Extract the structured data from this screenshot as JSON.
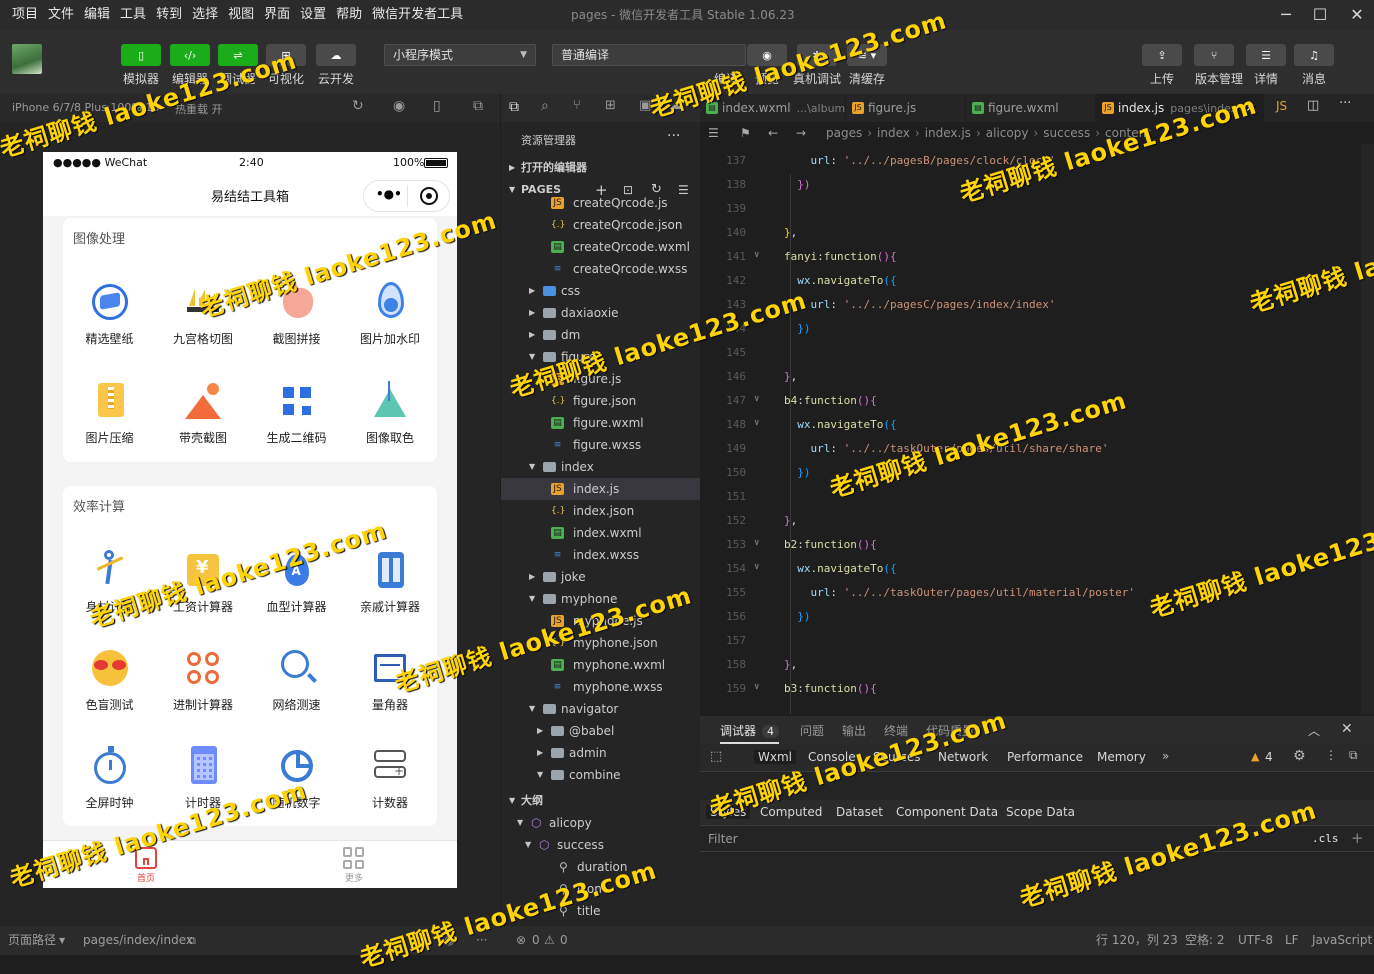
{
  "menu": [
    "项目",
    "文件",
    "编辑",
    "工具",
    "转到",
    "选择",
    "视图",
    "界面",
    "设置",
    "帮助",
    "微信开发者工具"
  ],
  "window_title": "pages - 微信开发者工具 Stable 1.06.23",
  "toolbar": {
    "left": [
      {
        "label": "模拟器",
        "icon": "phone-icon"
      },
      {
        "label": "编辑器",
        "icon": "code-icon"
      },
      {
        "label": "调试器",
        "icon": "debug-icon"
      },
      {
        "label": "可视化",
        "icon": "layout-icon"
      },
      {
        "label": "云开发",
        "icon": "cloud-icon"
      }
    ],
    "mode_select": "小程序模式",
    "compile_select": "普通编译",
    "mid": [
      {
        "label": "编译",
        "icon": "refresh-icon"
      },
      {
        "label": "预览",
        "icon": "eye-icon"
      },
      {
        "label": "真机调试",
        "icon": "bug-icon"
      },
      {
        "label": "清缓存",
        "icon": "layers-icon"
      }
    ],
    "right": [
      {
        "label": "上传",
        "icon": "upload-icon"
      },
      {
        "label": "版本管理",
        "icon": "branch-icon"
      },
      {
        "label": "详情",
        "icon": "menu-icon"
      },
      {
        "label": "消息",
        "icon": "bell-icon"
      }
    ]
  },
  "simulator": {
    "device": "iPhone 6/7/8 Plus 100% 16",
    "hot_reload": "热重载 开",
    "status_carrier": "●●●●● WeChat",
    "status_time": "2:40",
    "status_battery": "100%",
    "nav_title": "易结结工具箱",
    "sections": [
      {
        "title": "图像处理",
        "tools": [
          {
            "label": "精选壁纸",
            "icon": "wallpaper-icon"
          },
          {
            "label": "九宫格切图",
            "icon": "crown-grid-icon"
          },
          {
            "label": "截图拼接",
            "icon": "pig-icon"
          },
          {
            "label": "图片加水印",
            "icon": "water-drop-icon"
          },
          {
            "label": "图片压缩",
            "icon": "zip-icon"
          },
          {
            "label": "带壳截图",
            "icon": "mountain-icon"
          },
          {
            "label": "生成二维码",
            "icon": "qrcode-icon"
          },
          {
            "label": "图像取色",
            "icon": "color-picker-icon"
          }
        ]
      },
      {
        "title": "效率计算",
        "tools": [
          {
            "label": "身材计算",
            "icon": "body-icon"
          },
          {
            "label": "工资计算器",
            "icon": "yen-icon"
          },
          {
            "label": "血型计算器",
            "icon": "blood-drop-icon"
          },
          {
            "label": "亲戚计算器",
            "icon": "calculator-icon"
          },
          {
            "label": "色盲测试",
            "icon": "sunglasses-emoji-icon"
          },
          {
            "label": "进制计算器",
            "icon": "math-ops-icon"
          },
          {
            "label": "网络测速",
            "icon": "speed-search-icon"
          },
          {
            "label": "量角器",
            "icon": "ruler-icon"
          },
          {
            "label": "全屏时钟",
            "icon": "stopwatch-icon"
          },
          {
            "label": "计时器",
            "icon": "grid-calc-icon"
          },
          {
            "label": "随机数字",
            "icon": "pie-icon"
          },
          {
            "label": "计数器",
            "icon": "counter-icon"
          }
        ]
      }
    ],
    "tabs": [
      {
        "label": "首页",
        "icon": "home-icon"
      },
      {
        "label": "更多",
        "icon": "apps-icon"
      }
    ]
  },
  "explorer": {
    "title": "资源管理器",
    "open_editors": "打开的编辑器",
    "root": "PAGES",
    "outline": "大纲",
    "tree": [
      {
        "name": "createQrcode.js",
        "type": "js",
        "depth": 3
      },
      {
        "name": "createQrcode.json",
        "type": "json",
        "depth": 3
      },
      {
        "name": "createQrcode.wxml",
        "type": "wxml",
        "depth": 3
      },
      {
        "name": "createQrcode.wxss",
        "type": "wxss",
        "depth": 3
      },
      {
        "name": "css",
        "type": "folder-blue",
        "depth": 2,
        "state": "closed"
      },
      {
        "name": "daxiaoxie",
        "type": "folder",
        "depth": 2,
        "state": "closed"
      },
      {
        "name": "dm",
        "type": "folder",
        "depth": 2,
        "state": "closed"
      },
      {
        "name": "figure",
        "type": "folder",
        "depth": 2,
        "state": "open"
      },
      {
        "name": "figure.js",
        "type": "js",
        "depth": 3
      },
      {
        "name": "figure.json",
        "type": "json",
        "depth": 3
      },
      {
        "name": "figure.wxml",
        "type": "wxml",
        "depth": 3
      },
      {
        "name": "figure.wxss",
        "type": "wxss",
        "depth": 3
      },
      {
        "name": "index",
        "type": "folder",
        "depth": 2,
        "state": "open"
      },
      {
        "name": "index.js",
        "type": "js",
        "depth": 3,
        "selected": true
      },
      {
        "name": "index.json",
        "type": "json",
        "depth": 3
      },
      {
        "name": "index.wxml",
        "type": "wxml",
        "depth": 3
      },
      {
        "name": "index.wxss",
        "type": "wxss",
        "depth": 3
      },
      {
        "name": "joke",
        "type": "folder",
        "depth": 2,
        "state": "closed"
      },
      {
        "name": "myphone",
        "type": "folder",
        "depth": 2,
        "state": "open"
      },
      {
        "name": "myphone.js",
        "type": "js",
        "depth": 3
      },
      {
        "name": "myphone.json",
        "type": "json",
        "depth": 3
      },
      {
        "name": "myphone.wxml",
        "type": "wxml",
        "depth": 3
      },
      {
        "name": "myphone.wxss",
        "type": "wxss",
        "depth": 3
      },
      {
        "name": "navigator",
        "type": "folder",
        "depth": 2,
        "state": "open"
      },
      {
        "name": "@babel",
        "type": "folder",
        "depth": 3,
        "state": "closed"
      },
      {
        "name": "admin",
        "type": "folder",
        "depth": 3,
        "state": "closed"
      },
      {
        "name": "combine",
        "type": "folder",
        "depth": 3,
        "state": "open"
      }
    ],
    "outline_items": [
      {
        "name": "alicopy",
        "type": "cube",
        "depth": 1
      },
      {
        "name": "success",
        "type": "cube",
        "depth": 2
      },
      {
        "name": "duration",
        "type": "wrench",
        "depth": 3
      },
      {
        "name": "icon",
        "type": "wrench",
        "depth": 3
      },
      {
        "name": "title",
        "type": "wrench",
        "depth": 3
      }
    ]
  },
  "editor": {
    "tabs": [
      {
        "name": "index.wxml",
        "hint": "...\\album",
        "type": "wxml"
      },
      {
        "name": "figure.js",
        "hint": "",
        "type": "js"
      },
      {
        "name": "figure.wxml",
        "hint": "",
        "type": "wxml"
      },
      {
        "name": "index.js",
        "hint": "pages\\index",
        "type": "js",
        "active": true
      }
    ],
    "breadcrumb": [
      "pages",
      "index",
      "index.js",
      "alicopy",
      "success",
      "content"
    ],
    "lines": [
      {
        "n": "137",
        "fold": false,
        "html": "    <span class='v'>url</span>: <span class='s'>'../../pagesB/pages/clock/clock'</span>"
      },
      {
        "n": "138",
        "fold": false,
        "html": "  <span class='b'>})</span>"
      },
      {
        "n": "139",
        "fold": false,
        "html": ""
      },
      {
        "n": "140",
        "fold": false,
        "html": "<span class='p'>}</span>,"
      },
      {
        "n": "141",
        "fold": true,
        "html": "<span class='k'>fanyi</span>:<span class='k'>function</span><span class='b'>()</span><span class='b'>{</span>"
      },
      {
        "n": "142",
        "fold": false,
        "html": "  <span class='v'>wx</span>.<span class='k'>navigateTo</span><span class='bl'>({</span>"
      },
      {
        "n": "143",
        "fold": false,
        "html": "    <span class='v'>url</span>: <span class='s'>'../../pagesC/pages/index/index'</span>"
      },
      {
        "n": "144",
        "fold": false,
        "html": "  <span class='bl'>})</span>"
      },
      {
        "n": "145",
        "fold": false,
        "html": ""
      },
      {
        "n": "146",
        "fold": false,
        "html": "<span class='b'>}</span>,"
      },
      {
        "n": "147",
        "fold": true,
        "html": "<span class='k'>b4</span>:<span class='k'>function</span><span class='b'>()</span><span class='b'>{</span>"
      },
      {
        "n": "148",
        "fold": true,
        "html": "  <span class='v'>wx</span>.<span class='k'>navigateTo</span><span class='bl'>({</span>"
      },
      {
        "n": "149",
        "fold": false,
        "html": "    <span class='v'>url</span>: <span class='s'>'../../taskOuter/pages/util/share/share'</span>"
      },
      {
        "n": "150",
        "fold": false,
        "html": "  <span class='bl'>})</span>"
      },
      {
        "n": "151",
        "fold": false,
        "html": ""
      },
      {
        "n": "152",
        "fold": false,
        "html": "<span class='b'>}</span>,"
      },
      {
        "n": "153",
        "fold": true,
        "html": "<span class='k'>b2</span>:<span class='k'>function</span><span class='b'>()</span><span class='b'>{</span>"
      },
      {
        "n": "154",
        "fold": true,
        "html": "  <span class='v'>wx</span>.<span class='k'>navigateTo</span><span class='bl'>({</span>"
      },
      {
        "n": "155",
        "fold": false,
        "html": "    <span class='v'>url</span>: <span class='s'>'../../taskOuter/pages/util/material/poster'</span>"
      },
      {
        "n": "156",
        "fold": false,
        "html": "  <span class='bl'>})</span>"
      },
      {
        "n": "157",
        "fold": false,
        "html": ""
      },
      {
        "n": "158",
        "fold": false,
        "html": "<span class='b'>}</span>,"
      },
      {
        "n": "159",
        "fold": true,
        "html": "<span class='k'>b3</span>:<span class='k'>function</span><span class='b'>()</span><span class='b'>{</span>"
      }
    ]
  },
  "debugger": {
    "tabs": [
      {
        "label": "调试器",
        "badge": "4"
      },
      {
        "label": "问题"
      },
      {
        "label": "输出"
      },
      {
        "label": "终端"
      },
      {
        "label": "代码质量"
      }
    ],
    "devtools_tabs": [
      "Wxml",
      "Console",
      "Sources",
      "Network",
      "Performance",
      "Memory"
    ],
    "warning_count": "4",
    "style_tabs": [
      "Styles",
      "Computed",
      "Dataset",
      "Component Data",
      "Scope Data"
    ],
    "filter_placeholder": "Filter",
    "cls": ".cls"
  },
  "statusbar": {
    "path_label": "页面路径",
    "path": "pages/index/index",
    "errors": "0",
    "warnings": "0",
    "position": "行 120，列 23",
    "spaces": "空格: 2",
    "encoding": "UTF-8",
    "eol": "LF",
    "language": "JavaScript"
  },
  "watermark": "老祠聊钱 laoke123.com"
}
